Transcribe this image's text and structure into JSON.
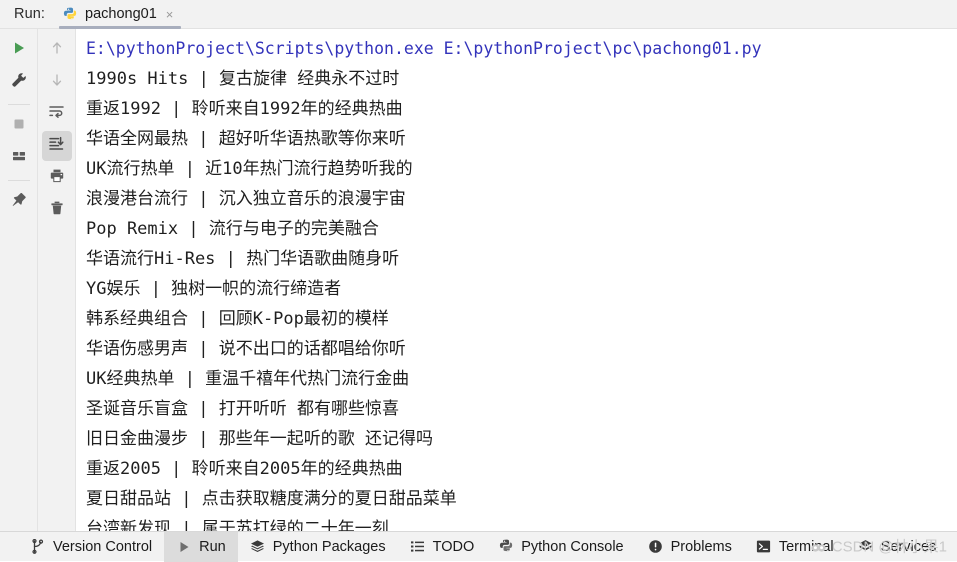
{
  "header": {
    "run_label": "Run:",
    "tab": {
      "icon": "python-logo-icon",
      "title": "pachong01",
      "close": "×"
    }
  },
  "toolbar_left": {
    "buttons": [
      {
        "name": "rerun-button",
        "icon": "play-icon"
      },
      {
        "name": "settings-button",
        "icon": "wrench-icon"
      },
      {
        "name": "stop-button",
        "icon": "stop-square-icon"
      },
      {
        "name": "layout-button",
        "icon": "layout-panels-icon"
      },
      {
        "name": "pin-tab-button",
        "icon": "pin-icon"
      }
    ]
  },
  "toolbar_right": {
    "buttons": [
      {
        "name": "prev-occurrence-button",
        "icon": "arrow-up-icon"
      },
      {
        "name": "next-occurrence-button",
        "icon": "arrow-down-icon"
      },
      {
        "name": "soft-wrap-button",
        "icon": "soft-wrap-icon"
      },
      {
        "name": "scroll-to-end-button",
        "icon": "scroll-to-end-icon",
        "selected": true
      },
      {
        "name": "print-button",
        "icon": "printer-icon"
      },
      {
        "name": "clear-all-button",
        "icon": "trash-icon"
      }
    ]
  },
  "console": {
    "command_line": "E:\\pythonProject\\Scripts\\python.exe E:\\pythonProject\\pc\\pachong01.py",
    "lines": [
      "1990s Hits  |  复古旋律 经典永不过时",
      "重返1992  |  聆听来自1992年的经典热曲",
      "华语全网最热  |  超好听华语热歌等你来听",
      "UK流行热单  |  近10年热门流行趋势听我的",
      "浪漫港台流行  |  沉入独立音乐的浪漫宇宙",
      "Pop Remix  |  流行与电子的完美融合",
      "华语流行Hi-Res  |  热门华语歌曲随身听",
      "YG娱乐  |  独树一帜的流行缔造者",
      "韩系经典组合  |  回顾K-Pop最初的模样",
      "华语伤感男声  |  说不出口的话都唱给你听",
      "UK经典热单  |  重温千禧年代热门流行金曲",
      "圣诞音乐盲盒  |  打开听听 都有哪些惊喜",
      "旧日金曲漫步  |  那些年一起听的歌 还记得吗",
      "重返2005  |  聆听来自2005年的经典热曲",
      "夏日甜品站  |  点击获取糖度满分的夏日甜品菜单",
      "台湾新发现  |  属于苏打绿的二十年一刻"
    ]
  },
  "statusbar": {
    "items": [
      {
        "label": "Version Control",
        "icon": "branch-icon",
        "active": false
      },
      {
        "label": "Run",
        "icon": "play-icon",
        "active": true
      },
      {
        "label": "Python Packages",
        "icon": "layers-icon",
        "active": false
      },
      {
        "label": "TODO",
        "icon": "list-icon",
        "active": false
      },
      {
        "label": "Python Console",
        "icon": "python-logo-icon",
        "active": false
      },
      {
        "label": "Problems",
        "icon": "warning-circle-icon",
        "active": false
      },
      {
        "label": "Terminal",
        "icon": "terminal-icon",
        "active": false
      },
      {
        "label": "Services",
        "icon": "services-icon",
        "active": false
      }
    ],
    "watermark": "CSDN @林小果1"
  },
  "colors": {
    "command_text": "#3333bb",
    "output_text": "#1f1f1f",
    "panel_bg": "#f2f2f2",
    "tab_underline": "#a8aebd",
    "selected_icon_bg": "#d6d6d6",
    "play_green": "#499c54"
  }
}
